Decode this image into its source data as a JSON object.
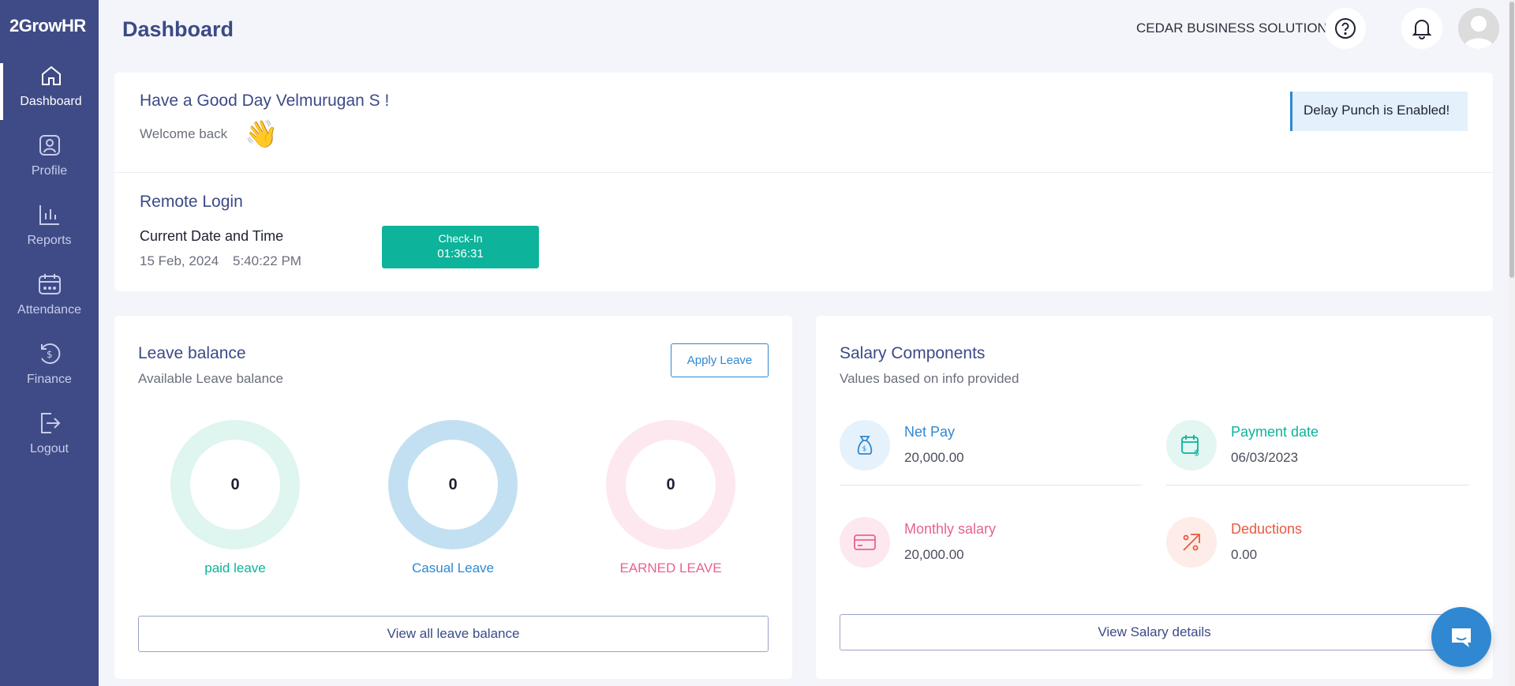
{
  "app": {
    "logo_text": "2GrowHR"
  },
  "sidebar": {
    "items": [
      {
        "label": "Dashboard",
        "icon": "home-icon"
      },
      {
        "label": "Profile",
        "icon": "profile-icon"
      },
      {
        "label": "Reports",
        "icon": "bar-chart-icon"
      },
      {
        "label": "Attendance",
        "icon": "calendar-icon"
      },
      {
        "label": "Finance",
        "icon": "finance-icon"
      },
      {
        "label": "Logout",
        "icon": "logout-icon"
      }
    ],
    "active": "Dashboard"
  },
  "header": {
    "title": "Dashboard",
    "company": "CEDAR BUSINESS SOLUTION"
  },
  "welcome": {
    "greeting": "Have a Good Day Velmurugan S !",
    "subtext": "Welcome back",
    "banner": "Delay Punch is Enabled!"
  },
  "remote_login": {
    "title": "Remote Login",
    "label": "Current Date and Time",
    "date": "15 Feb, 2024",
    "time": "5:40:22 PM",
    "checkin_label": "Check-In",
    "checkin_timer": "01:36:31"
  },
  "leave": {
    "title": "Leave balance",
    "subtitle": "Available Leave balance",
    "apply_label": "Apply Leave",
    "items": [
      {
        "label": "paid leave",
        "value": "0",
        "ring_color": "#dff5ef",
        "label_color": "#0db39a"
      },
      {
        "label": "Casual Leave",
        "value": "0",
        "ring_color": "#c3e0f2",
        "label_color": "#2f88d1"
      },
      {
        "label": "EARNED LEAVE",
        "value": "0",
        "ring_color": "#fde8ef",
        "label_color": "#e9638b"
      }
    ],
    "view_all_label": "View all leave balance"
  },
  "salary": {
    "title": "Salary Components",
    "subtitle": "Values based on info provided",
    "items": [
      {
        "label": "Net Pay",
        "value": "20,000.00",
        "color": "#2f88d1",
        "bg": "#e6f2fb",
        "icon": "money-bag-icon"
      },
      {
        "label": "Payment date",
        "value": "06/03/2023",
        "color": "#0db39a",
        "bg": "#e3f6f2",
        "icon": "calendar-dollar-icon"
      },
      {
        "label": "Monthly salary",
        "value": "20,000.00",
        "color": "#e9638b",
        "bg": "#fde8ef",
        "icon": "credit-card-icon"
      },
      {
        "label": "Deductions",
        "value": "0.00",
        "color": "#e8593f",
        "bg": "#fdece8",
        "icon": "trend-arrow-icon"
      }
    ],
    "view_label": "View Salary details"
  }
}
